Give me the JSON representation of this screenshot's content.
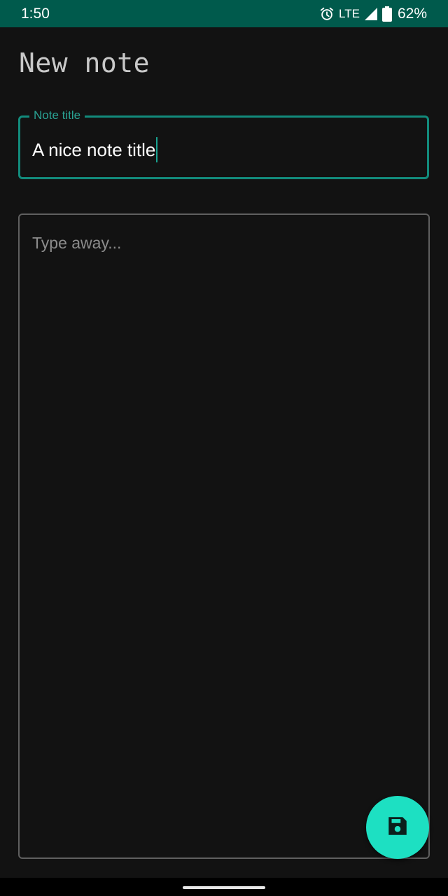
{
  "status_bar": {
    "time": "1:50",
    "network": "LTE",
    "battery_percent": "62%",
    "icons": [
      "alarm-icon",
      "signal-icon",
      "battery-icon"
    ]
  },
  "page": {
    "title": "New note"
  },
  "title_field": {
    "label": "Note title",
    "value": "A nice note title"
  },
  "body_field": {
    "placeholder": "Type away..."
  },
  "fab": {
    "icon": "save-icon"
  },
  "colors": {
    "status_bar_bg": "#005a4c",
    "background": "#121212",
    "accent": "#1de0c2",
    "field_focus_border": "#128b7c"
  }
}
